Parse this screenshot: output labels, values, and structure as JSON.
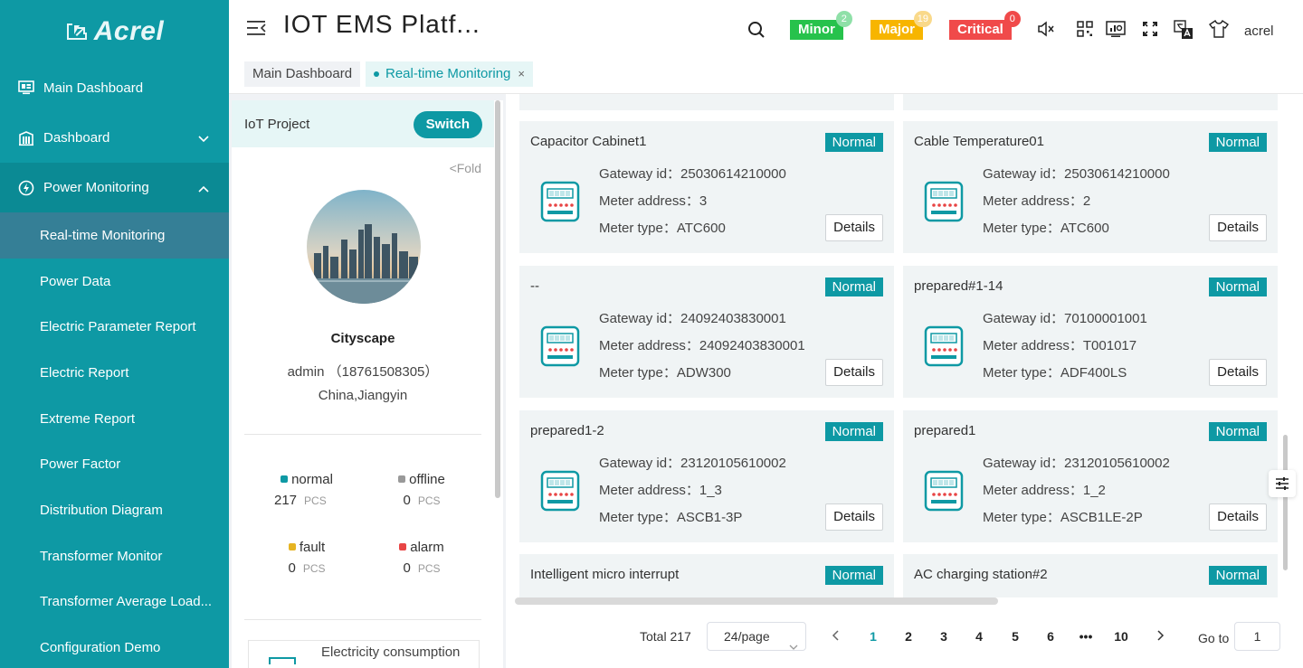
{
  "logo": {
    "text": "Acrel"
  },
  "sidebar": {
    "items": [
      {
        "label": "Main Dashboard",
        "icon": "monitor-icon"
      },
      {
        "label": "Dashboard",
        "icon": "building-icon"
      },
      {
        "label": "Power Monitoring",
        "icon": "power-icon"
      }
    ],
    "sub_items": [
      "Real-time Monitoring",
      "Power Data",
      "Electric Parameter Report",
      "Electric Report",
      "Extreme Report",
      "Power Factor",
      "Distribution Diagram",
      "Transformer Monitor",
      "Transformer Average Load...",
      "Configuration Demo"
    ]
  },
  "header": {
    "title": "IOT EMS Platf...",
    "alarms": [
      {
        "label": "Minor",
        "count": "2",
        "color": "#27c24c",
        "count_color": "#8fe0a8"
      },
      {
        "label": "Major",
        "count": "19",
        "color": "#f7b500",
        "count_color": "#f9d98a"
      },
      {
        "label": "Critical",
        "count": "0",
        "color": "#f04a4a",
        "count_color": "#f04a4a"
      }
    ],
    "user": "acrel"
  },
  "tabs": [
    {
      "label": "Main Dashboard"
    },
    {
      "label": "Real-time Monitoring",
      "close": "×"
    }
  ],
  "project": {
    "header": "IoT Project",
    "switch_label": "Switch",
    "fold_label": "<Fold",
    "name": "Cityscape",
    "admin": "admin （18761508305）",
    "location": "China,Jiangyin",
    "stats": [
      {
        "label": "normal",
        "value": "217",
        "unit": "PCS",
        "color": "#0e99a4"
      },
      {
        "label": "offline",
        "value": "0",
        "unit": "PCS",
        "color": "#999999"
      },
      {
        "label": "fault",
        "value": "0",
        "unit": "PCS",
        "color": "#e6b422"
      },
      {
        "label": "alarm",
        "value": "0",
        "unit": "PCS",
        "color": "#e84545"
      }
    ],
    "bottom_card": "Electricity consumption"
  },
  "cards": [
    {
      "title": "Capacitor Cabinet1",
      "status": "Normal",
      "gateway": "25030614210000",
      "address": "3",
      "type": "ATC600"
    },
    {
      "title": "Cable Temperature01",
      "status": "Normal",
      "gateway": "25030614210000",
      "address": "2",
      "type": "ATC600"
    },
    {
      "title": "--",
      "status": "Normal",
      "gateway": "24092403830001",
      "address": "24092403830001",
      "type": "ADW300"
    },
    {
      "title": "prepared#1-14",
      "status": "Normal",
      "gateway": "70100001001",
      "address": "T001017",
      "type": "ADF400LS"
    },
    {
      "title": "prepared1-2",
      "status": "Normal",
      "gateway": "23120105610002",
      "address": "1_3",
      "type": "ASCB1-3P"
    },
    {
      "title": "prepared1",
      "status": "Normal",
      "gateway": "23120105610002",
      "address": "1_2",
      "type": "ASCB1LE-2P"
    },
    {
      "title": "Intelligent micro interrupt",
      "status": "Normal"
    },
    {
      "title": "AC charging station#2",
      "status": "Normal"
    }
  ],
  "card_labels": {
    "gateway": "Gateway id：",
    "address": "Meter address：",
    "type": "Meter type：",
    "details": "Details"
  },
  "pagination": {
    "total": "Total 217",
    "page_size": "24/page",
    "pages": [
      "1",
      "2",
      "3",
      "4",
      "5",
      "6",
      "•••",
      "10"
    ],
    "current": "1",
    "goto_label": "Go to",
    "goto_value": "1"
  }
}
